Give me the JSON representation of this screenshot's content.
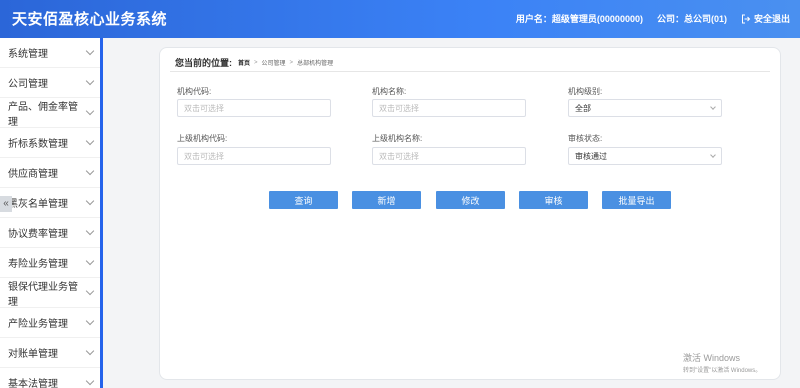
{
  "header": {
    "title": "天安佰盈核心业务系统",
    "user_label": "用户名：超级管理员(00000000)",
    "company_label": "公司：总公司(01)",
    "logout_label": "安全退出"
  },
  "sidebar": {
    "items": [
      {
        "label": "系统管理"
      },
      {
        "label": "公司管理"
      },
      {
        "label": "产品、佣金率管理"
      },
      {
        "label": "折标系数管理"
      },
      {
        "label": "供应商管理"
      },
      {
        "label": "黑灰名单管理"
      },
      {
        "label": "协议费率管理"
      },
      {
        "label": "寿险业务管理"
      },
      {
        "label": "银保代理业务管理"
      },
      {
        "label": "产险业务管理"
      },
      {
        "label": "对账单管理"
      },
      {
        "label": "基本法管理"
      }
    ],
    "collapse_glyph": "«"
  },
  "breadcrumb": {
    "lead": "您当前的位置:",
    "home": "首页",
    "separator": ">",
    "level1": "公司管理",
    "level2": "总部机构管理"
  },
  "form": {
    "org_code_label": "机构代码:",
    "org_code_placeholder": "双击可选择",
    "org_name_label": "机构名称:",
    "org_name_placeholder": "双击可选择",
    "org_level_label": "机构级别:",
    "org_level_value": "全部",
    "parent_code_label": "上级机构代码:",
    "parent_code_placeholder": "双击可选择",
    "parent_name_label": "上级机构名称:",
    "parent_name_placeholder": "双击可选择",
    "audit_status_label": "审核状态:",
    "audit_status_value": "审核通过"
  },
  "actions": {
    "query": "查询",
    "add": "新增",
    "edit": "修改",
    "audit": "审核",
    "export": "批量导出"
  },
  "watermark": {
    "line1": "激活 Windows",
    "line2": "转到\"设置\"以激活 Windows。"
  },
  "colors": {
    "header_start": "#2b66d8",
    "header_end": "#4a90f0",
    "button": "#4a90e2",
    "sidebar_accent": "#2563eb"
  }
}
